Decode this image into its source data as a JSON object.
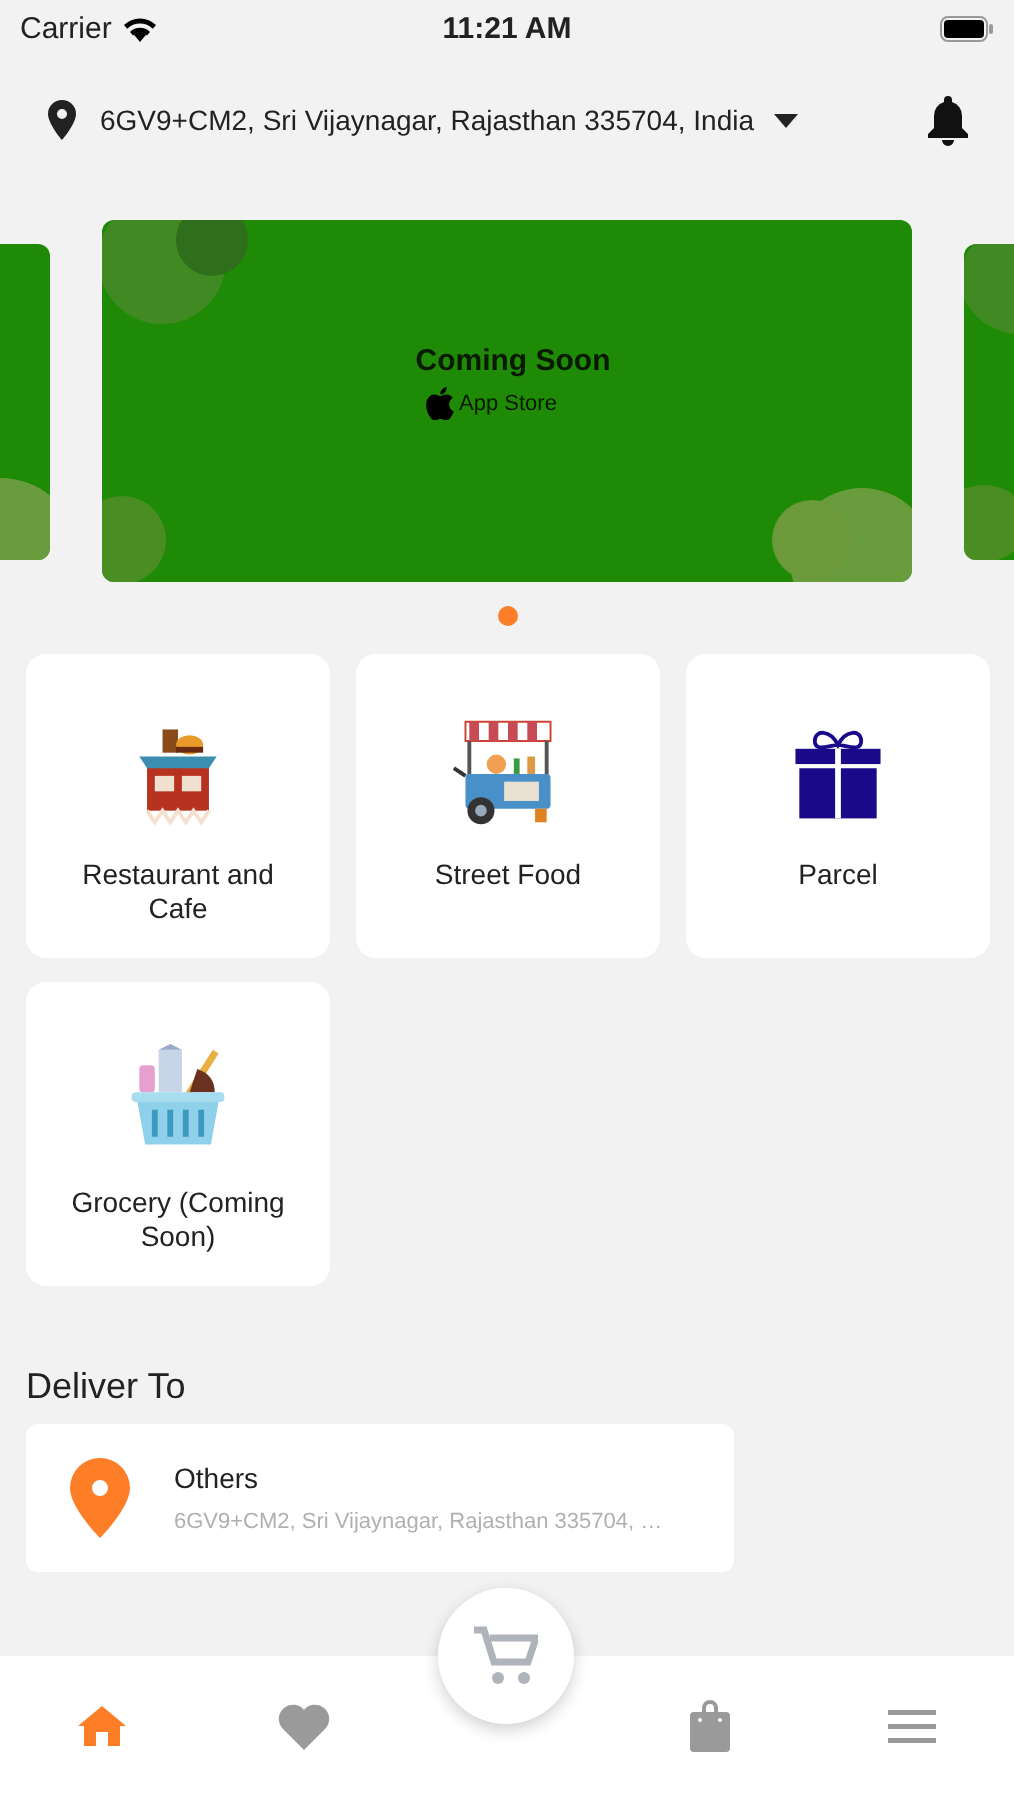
{
  "status_bar": {
    "carrier": "Carrier",
    "time": "11:21 AM"
  },
  "location_bar": {
    "address": "6GV9+CM2, Sri Vijaynagar, Rajasthan 335704, India"
  },
  "banner": {
    "title": "Coming Soon",
    "subtitle": "App Store"
  },
  "carousel_dots": [
    {
      "selected": true
    }
  ],
  "categories": [
    {
      "kind": "restaurant",
      "label": "Restaurant and Cafe"
    },
    {
      "kind": "street_food",
      "label": "Street Food"
    },
    {
      "kind": "parcel",
      "label": "Parcel"
    },
    {
      "kind": "grocery",
      "label": "Grocery (Coming Soon)"
    }
  ],
  "deliver_to": {
    "heading": "Deliver To",
    "label": "Others",
    "address": "6GV9+CM2, Sri Vijaynagar, Rajasthan 335704, …"
  },
  "bottom_nav": [
    {
      "kind": "home",
      "selected": true
    },
    {
      "kind": "favorites",
      "selected": false
    },
    {
      "kind": "cart",
      "selected": false
    },
    {
      "kind": "orders",
      "selected": false
    },
    {
      "kind": "menu",
      "selected": false
    }
  ]
}
